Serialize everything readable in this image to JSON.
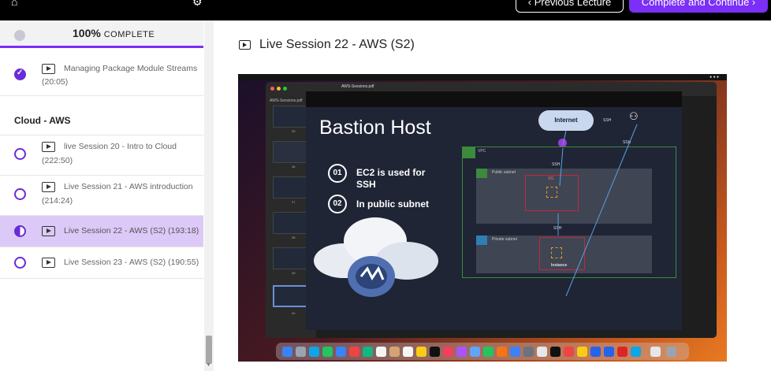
{
  "topbar": {
    "prev_label": "‹ Previous Lecture",
    "next_label": "Complete and Continue ›"
  },
  "sidebar": {
    "progress_pct": "100%",
    "progress_word": "COMPLETE",
    "progress_value": 1.0,
    "previous_item": {
      "title": "Managing Package Module Streams",
      "duration": "(20:05)",
      "status": "completed"
    },
    "section_title": "Cloud - AWS",
    "items": [
      {
        "title": "live Session 20 - Intro to Cloud",
        "duration": "(222:50)",
        "status": "not-started"
      },
      {
        "title": "Live Session 21 - AWS introduction",
        "duration": "(214:24)",
        "status": "not-started"
      },
      {
        "title": "Live Session 22 - AWS (S2) (193:18)",
        "duration": "",
        "status": "in-progress"
      },
      {
        "title": "Live Session 23 - AWS (S2) (190:55)",
        "duration": "",
        "status": "not-started"
      }
    ]
  },
  "main": {
    "lecture_title": "Live Session 22 - AWS (S2)"
  },
  "video": {
    "window_file": "AWS-Sessions.pdf",
    "thumbs_label": "AWS-Sessions.pdf",
    "thumb_numbers": [
      "35",
      "36",
      "37",
      "38",
      "39",
      "40"
    ],
    "slide": {
      "heading": "Bastion Host",
      "bullets": [
        {
          "num": "01",
          "text": "EC2 is used for SSH"
        },
        {
          "num": "02",
          "text": "In public subnet"
        }
      ],
      "internet_label": "Internet",
      "ssh_labels": [
        "SSH",
        "SSH",
        "SSH",
        "SSH"
      ],
      "vpc_label": "VPC",
      "public_subnet_label": "Public subnet",
      "private_subnet_label": "Private subnet",
      "sg_label": "SG",
      "instance_label": "Instance"
    }
  },
  "colors": {
    "accent": "#7b2ff7",
    "active_row": "#dcc9f7",
    "check": "#6a2bd9"
  }
}
